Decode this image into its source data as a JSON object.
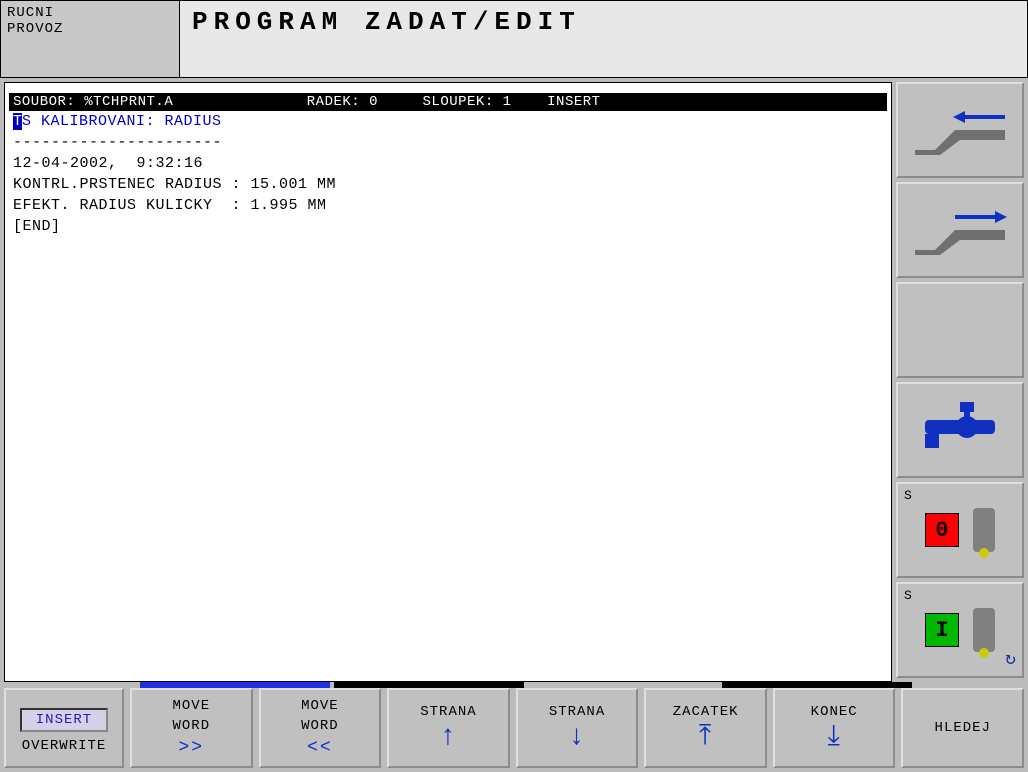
{
  "header": {
    "mode_line1": "RUCNI",
    "mode_line2": "PROVOZ",
    "title": "PROGRAM ZADAT/EDIT"
  },
  "status": {
    "file_label": "SOUBOR:",
    "file_value": "%TCHPRNT.A",
    "row_label": "RADEK:",
    "row_value": "0",
    "col_label": "SLOUPEK:",
    "col_value": "1",
    "mode": "INSERT"
  },
  "lines": {
    "heading_rest": "S KALIBROVANI: RADIUS",
    "divider": "----------------------",
    "timestamp": "12-04-2002,  9:32:16",
    "ring": "KONTRL.PRSTENEC RADIUS : 15.001 MM",
    "ball": "EFEKT. RADIUS KULICKY  : 1.995 MM",
    "end": "[END]"
  },
  "right": {
    "s_label": "S",
    "s0": "0",
    "s1": "I"
  },
  "bottom": {
    "insert": "INSERT",
    "overwrite": "OVERWRITE",
    "move_word": "MOVE",
    "move_word2": "WORD",
    "fwd": ">>",
    "back": "<<",
    "page": "STRANA",
    "start": "ZACATEK",
    "end": "KONEC",
    "find": "HLEDEJ"
  }
}
